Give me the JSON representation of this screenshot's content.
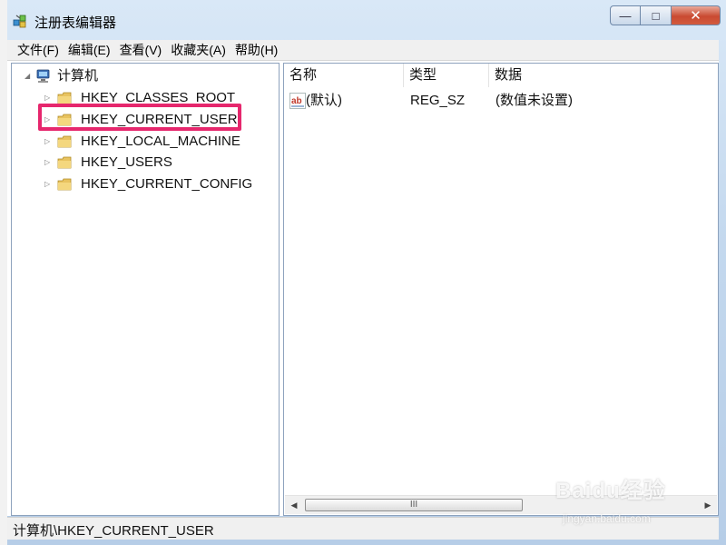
{
  "window": {
    "title": "注册表编辑器",
    "minimize_label": "—",
    "maximize_label": "□",
    "close_label": "✕"
  },
  "menu": {
    "items": [
      "文件(F)",
      "编辑(E)",
      "查看(V)",
      "收藏夹(A)",
      "帮助(H)"
    ]
  },
  "tree": {
    "root_label": "计算机",
    "root_icon": "computer-icon",
    "items": [
      {
        "label": "HKEY_CLASSES_ROOT",
        "icon": "folder-icon",
        "highlighted": false
      },
      {
        "label": "HKEY_CURRENT_USER",
        "icon": "folder-icon",
        "highlighted": true
      },
      {
        "label": "HKEY_LOCAL_MACHINE",
        "icon": "folder-icon",
        "highlighted": false
      },
      {
        "label": "HKEY_USERS",
        "icon": "folder-icon",
        "highlighted": false
      },
      {
        "label": "HKEY_CURRENT_CONFIG",
        "icon": "folder-icon",
        "highlighted": false
      }
    ],
    "highlight_color": "#e6276d"
  },
  "list": {
    "columns": [
      "名称",
      "类型",
      "数据"
    ],
    "rows": [
      {
        "name": "(默认)",
        "type": "REG_SZ",
        "data": "(数值未设置)",
        "icon": "string-value-icon"
      }
    ],
    "scroll_thumb_label": "III"
  },
  "status": {
    "path": "计算机\\HKEY_CURRENT_USER"
  },
  "watermark": {
    "brand": "Baidu经验",
    "url": "jingyan.baidu.com"
  }
}
